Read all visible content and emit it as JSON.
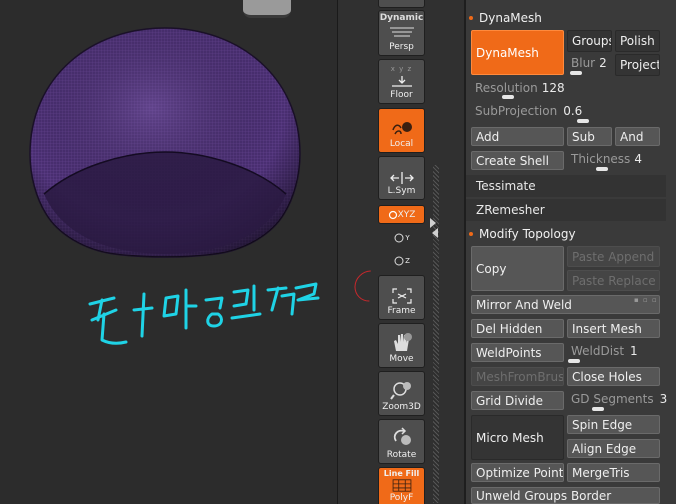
{
  "shelf": {
    "dynamic_label": "Dynamic",
    "persp_label": "Persp",
    "floor_label": "Floor",
    "local_label": "Local",
    "lsym_label": "L.Sym",
    "xyz_label": "XYZ",
    "y_label": "Y",
    "z_label": "Z",
    "frame_label": "Frame",
    "move_label": "Move",
    "zoom3d_label": "Zoom3D",
    "rotate_label": "Rotate",
    "linefill_label": "Line Fill",
    "polyf_label": "PolyF"
  },
  "dynamesh": {
    "header": "DynaMesh",
    "main_button": "DynaMesh",
    "groups": "Groups",
    "polish": "Polish",
    "blur_label": "Blur",
    "blur_value": "2",
    "project": "Project",
    "resolution_label": "Resolution",
    "resolution_value": "128",
    "resolution_fraction": 0.06,
    "subprojection_label": "SubProjection",
    "subprojection_value": "0.6",
    "subprojection_fraction": 0.6,
    "add": "Add",
    "sub": "Sub",
    "and": "And",
    "create_shell": "Create Shell",
    "thickness_label": "Thickness",
    "thickness_value": "4"
  },
  "subpalettes": {
    "tessimate": "Tessimate",
    "zremesher": "ZRemesher"
  },
  "modify_topology": {
    "header": "Modify Topology",
    "copy": "Copy",
    "paste_append": "Paste Append",
    "paste_replace": "Paste Replace",
    "mirror_and_weld": "Mirror And Weld",
    "del_hidden": "Del Hidden",
    "insert_mesh": "Insert Mesh",
    "weld_points": "WeldPoints",
    "welddist_label": "WeldDist",
    "welddist_value": "1",
    "mesh_from_brush": "MeshFromBrush",
    "close_holes": "Close Holes",
    "grid_divide": "Grid Divide",
    "gd_segments_label": "GD Segments",
    "gd_segments_value": "3",
    "micro_mesh": "Micro Mesh",
    "spin_edge": "Spin Edge",
    "align_edge": "Align Edge",
    "optimize_points": "Optimize Points",
    "merge_tris": "MergeTris",
    "unweld_groups_border": "Unweld Groups Border"
  },
  "icons": [
    "persp-icon",
    "floor-icon",
    "local-icon",
    "lsym-icon",
    "xyz-icon",
    "frame-icon",
    "move-hand-icon",
    "zoom3d-icon",
    "rotate-icon",
    "polyframe-icon"
  ],
  "colors": {
    "accent": "#f06a18",
    "mesh": "#5a3a86",
    "handwriting": "#1fd3e6"
  }
}
